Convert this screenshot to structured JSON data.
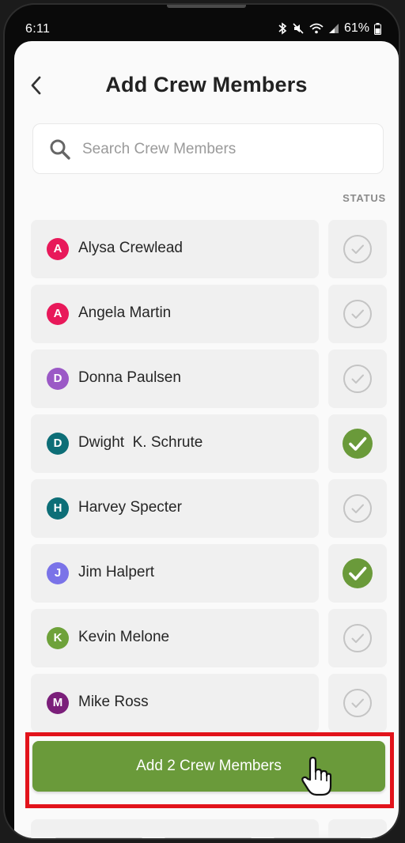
{
  "statusbar": {
    "time": "6:11",
    "battery": "61%"
  },
  "header": {
    "title": "Add Crew Members"
  },
  "search": {
    "placeholder": "Search Crew Members",
    "value": ""
  },
  "list": {
    "status_label": "STATUS",
    "members": [
      {
        "initial": "A",
        "name": "Alysa Crewlead",
        "color": "#e8195a",
        "selected": false
      },
      {
        "initial": "A",
        "name": "Angela Martin",
        "color": "#e8195a",
        "selected": false
      },
      {
        "initial": "D",
        "name": "Donna Paulsen",
        "color": "#9b59c6",
        "selected": false
      },
      {
        "initial": "D",
        "name": "Dwight  K. Schrute",
        "color": "#0d6e77",
        "selected": true
      },
      {
        "initial": "H",
        "name": "Harvey Specter",
        "color": "#0d6e77",
        "selected": false
      },
      {
        "initial": "J",
        "name": "Jim Halpert",
        "color": "#7a73e8",
        "selected": true
      },
      {
        "initial": "K",
        "name": "Kevin Melone",
        "color": "#6ea23a",
        "selected": false
      },
      {
        "initial": "M",
        "name": "Mike Ross",
        "color": "#7b1f7a",
        "selected": false
      }
    ]
  },
  "action": {
    "label": "Add 2 Crew Members"
  },
  "colors": {
    "accent": "#6a9a3a",
    "highlight": "#e2131b"
  },
  "icons": {
    "back": "chevron-left-icon",
    "search": "search-icon",
    "status_unchecked": "check-circle-outline-icon",
    "status_checked": "check-circle-filled-icon",
    "cursor": "hand-pointer-icon"
  }
}
